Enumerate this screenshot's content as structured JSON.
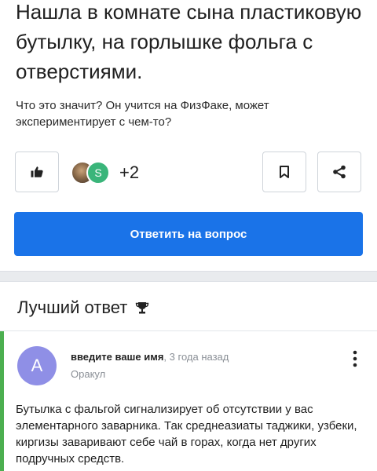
{
  "question": {
    "title": "Нашла в комнате сына пластиковую бутылку, на горлышке фольга с отверстиями.",
    "body": "Что это значит? Он учится на ФизФаке, может экспериментирует с чем-то?",
    "reactions": {
      "avatar_letter": "S",
      "count": "+2"
    },
    "answer_button": "Ответить на вопрос"
  },
  "best_answer": {
    "header": "Лучший ответ",
    "author": {
      "initial": "A",
      "name": "введите ваше имя",
      "time": ", 3 года назад",
      "rank": "Оракул"
    },
    "text": "Бутылка с фальгой сигнализирует об отсутствии у вас элементарного заварника. Так среднеазиаты таджики, узбеки, киргизы заваривают себе чай в горах, когда нет других подручных средств."
  },
  "colors": {
    "primary": "#1a73e8",
    "accent_green": "#4caf50",
    "avatar_purple": "#8f8fe6",
    "badge_green": "#3ab57a"
  },
  "icons": [
    "thumbs-up-icon",
    "bookmark-icon",
    "share-icon",
    "trophy-icon",
    "more-vertical-icon"
  ]
}
